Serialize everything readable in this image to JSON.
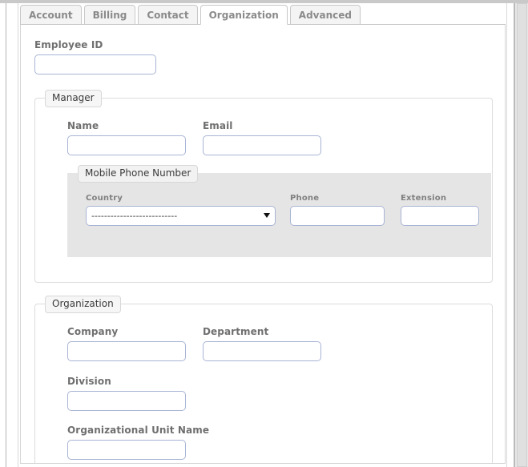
{
  "tabs": [
    {
      "label": "Account",
      "active": false
    },
    {
      "label": "Billing",
      "active": false
    },
    {
      "label": "Contact",
      "active": false
    },
    {
      "label": "Organization",
      "active": true
    },
    {
      "label": "Advanced",
      "active": false
    }
  ],
  "form": {
    "employee_id": {
      "label": "Employee ID",
      "value": "",
      "placeholder": ""
    },
    "manager": {
      "legend": "Manager",
      "name": {
        "label": "Name",
        "value": "",
        "placeholder": ""
      },
      "email": {
        "label": "Email",
        "value": "",
        "placeholder": ""
      },
      "mobile_phone": {
        "legend": "Mobile Phone Number",
        "country": {
          "label": "Country",
          "selected": "---------------------------",
          "options": [
            "---------------------------"
          ]
        },
        "phone": {
          "label": "Phone",
          "value": "",
          "placeholder": ""
        },
        "extension": {
          "label": "Extension",
          "value": "",
          "placeholder": ""
        }
      }
    },
    "organization": {
      "legend": "Organization",
      "company": {
        "label": "Company",
        "value": "",
        "placeholder": ""
      },
      "department": {
        "label": "Department",
        "value": "",
        "placeholder": ""
      },
      "division": {
        "label": "Division",
        "value": "",
        "placeholder": ""
      },
      "org_unit_name": {
        "label": "Organizational Unit Name",
        "value": "",
        "placeholder": ""
      }
    }
  },
  "colors": {
    "input_border": "#a8b4d4",
    "fieldset_border": "#dcdcdc",
    "grey_box_bg": "#e5e5e5",
    "tab_inactive_bg": "#f4f4f4",
    "tab_active_bg": "#ffffff",
    "label_text": "#6f6f6f",
    "tab_text": "#8a8a8a"
  },
  "icons": {
    "dropdown": "chevron-down-icon"
  }
}
